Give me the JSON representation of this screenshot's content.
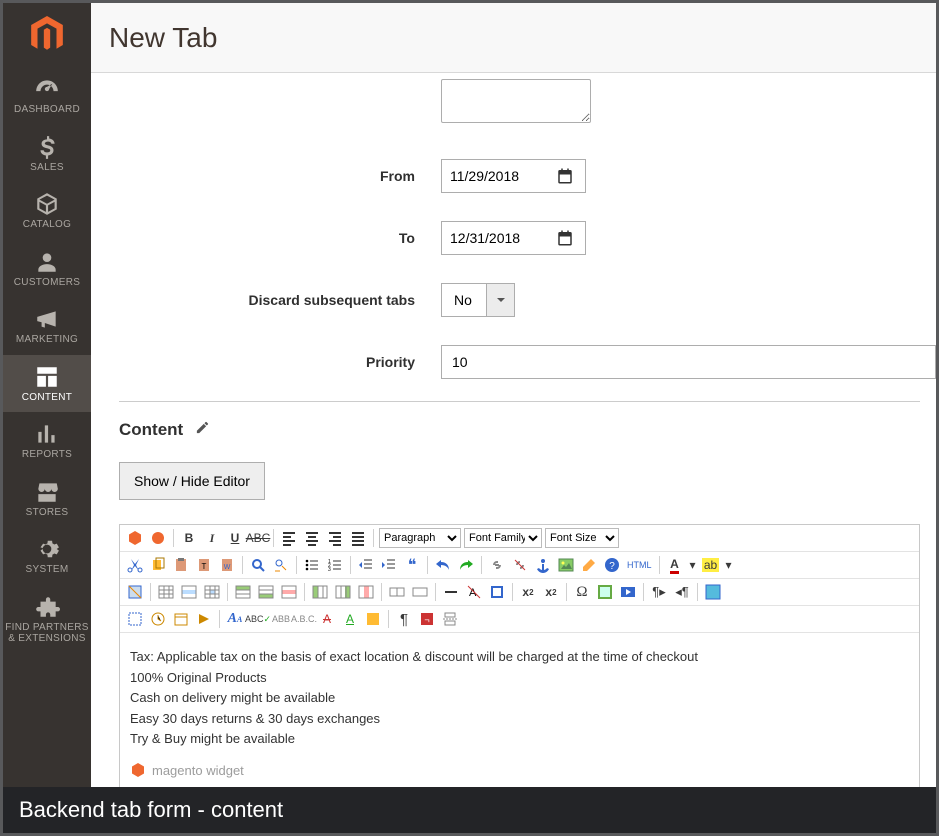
{
  "caption": "Backend tab form - content",
  "header": {
    "title": "New Tab"
  },
  "sidebar": {
    "items": [
      {
        "label": "DASHBOARD"
      },
      {
        "label": "SALES"
      },
      {
        "label": "CATALOG"
      },
      {
        "label": "CUSTOMERS"
      },
      {
        "label": "MARKETING"
      },
      {
        "label": "CONTENT"
      },
      {
        "label": "REPORTS"
      },
      {
        "label": "STORES"
      },
      {
        "label": "SYSTEM"
      },
      {
        "label": "FIND PARTNERS\n& EXTENSIONS"
      }
    ],
    "active_index": 5
  },
  "form": {
    "from": {
      "label": "From",
      "value": "11/29/2018"
    },
    "to": {
      "label": "To",
      "value": "12/31/2018"
    },
    "discard": {
      "label": "Discard subsequent tabs",
      "value": "No"
    },
    "priority": {
      "label": "Priority",
      "value": "10"
    }
  },
  "content_section": {
    "heading": "Content",
    "toggle_button": "Show / Hide Editor",
    "dropdowns": {
      "block_format": "Paragraph",
      "font_family": "Font Family",
      "font_size": "Font Size"
    },
    "body_lines": [
      "Tax: Applicable tax on the basis of exact location & discount will be charged at the time of checkout",
      "100% Original Products",
      "Cash on delivery might be available",
      "Easy 30 days returns & 30 days exchanges",
      "Try & Buy might be available"
    ],
    "widget_tag": "magento widget",
    "html_toolbar_label": "HTML"
  }
}
